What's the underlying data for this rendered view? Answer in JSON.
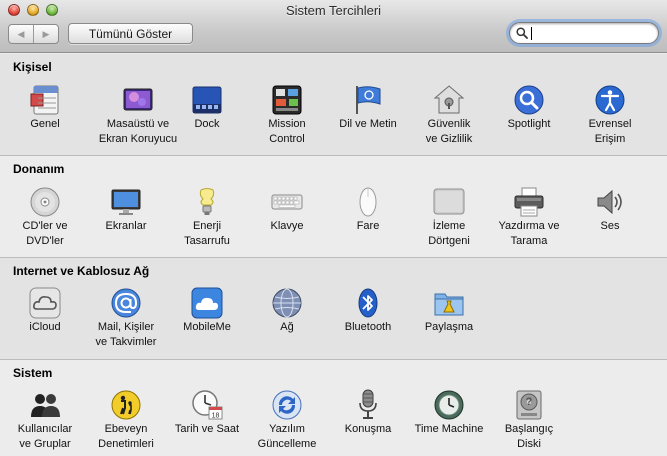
{
  "window": {
    "title": "Sistem Tercihleri"
  },
  "toolbar": {
    "back_label": "◀",
    "forward_label": "▶",
    "show_all_label": "Tümünü Göster",
    "search": {
      "value": "",
      "placeholder": ""
    }
  },
  "sections": [
    {
      "title": "Kişisel",
      "items": [
        {
          "label1": "Genel",
          "label2": "",
          "icon": "general-icon"
        },
        {
          "label1": "Masaüstü ve",
          "label2": "Ekran Koruyucu",
          "icon": "desktop-screensaver-icon"
        },
        {
          "label1": "Dock",
          "label2": "",
          "icon": "dock-icon"
        },
        {
          "label1": "Mission",
          "label2": "Control",
          "icon": "mission-control-icon"
        },
        {
          "label1": "Dil ve Metin",
          "label2": "",
          "icon": "language-flag-icon"
        },
        {
          "label1": "Güvenlik",
          "label2": "ve Gizlilik",
          "icon": "security-house-icon"
        },
        {
          "label1": "Spotlight",
          "label2": "",
          "icon": "spotlight-icon"
        },
        {
          "label1": "Evrensel",
          "label2": "Erişim",
          "icon": "accessibility-icon"
        }
      ]
    },
    {
      "title": "Donanım",
      "items": [
        {
          "label1": "CD'ler ve",
          "label2": "DVD'ler",
          "icon": "cd-dvd-icon"
        },
        {
          "label1": "Ekranlar",
          "label2": "",
          "icon": "display-icon"
        },
        {
          "label1": "Enerji",
          "label2": "Tasarrufu",
          "icon": "energy-bulb-icon"
        },
        {
          "label1": "Klavye",
          "label2": "",
          "icon": "keyboard-icon"
        },
        {
          "label1": "Fare",
          "label2": "",
          "icon": "mouse-icon"
        },
        {
          "label1": "İzleme",
          "label2": "Dörtgeni",
          "icon": "trackpad-icon"
        },
        {
          "label1": "Yazdırma ve",
          "label2": "Tarama",
          "icon": "printer-icon"
        },
        {
          "label1": "Ses",
          "label2": "",
          "icon": "speaker-icon"
        }
      ]
    },
    {
      "title": "Internet ve Kablosuz Ağ",
      "items": [
        {
          "label1": "iCloud",
          "label2": "",
          "icon": "icloud-icon"
        },
        {
          "label1": "Mail, Kişiler",
          "label2": "ve Takvimler",
          "icon": "mail-at-icon"
        },
        {
          "label1": "MobileMe",
          "label2": "",
          "icon": "mobileme-cloud-icon"
        },
        {
          "label1": "Ağ",
          "label2": "",
          "icon": "network-globe-icon"
        },
        {
          "label1": "Bluetooth",
          "label2": "",
          "icon": "bluetooth-icon"
        },
        {
          "label1": "Paylaşma",
          "label2": "",
          "icon": "sharing-folder-icon"
        }
      ]
    },
    {
      "title": "Sistem",
      "items": [
        {
          "label1": "Kullanıcılar",
          "label2": "ve Gruplar",
          "icon": "users-groups-icon"
        },
        {
          "label1": "Ebeveyn",
          "label2": "Denetimleri",
          "icon": "parental-controls-icon"
        },
        {
          "label1": "Tarih ve Saat",
          "label2": "",
          "icon": "date-time-clock-icon"
        },
        {
          "label1": "Yazılım",
          "label2": "Güncelleme",
          "icon": "software-update-icon"
        },
        {
          "label1": "Konuşma",
          "label2": "",
          "icon": "speech-microphone-icon"
        },
        {
          "label1": "Time Machine",
          "label2": "",
          "icon": "time-machine-icon"
        },
        {
          "label1": "Başlangıç",
          "label2": "Diski",
          "icon": "startup-disk-icon"
        }
      ]
    }
  ]
}
